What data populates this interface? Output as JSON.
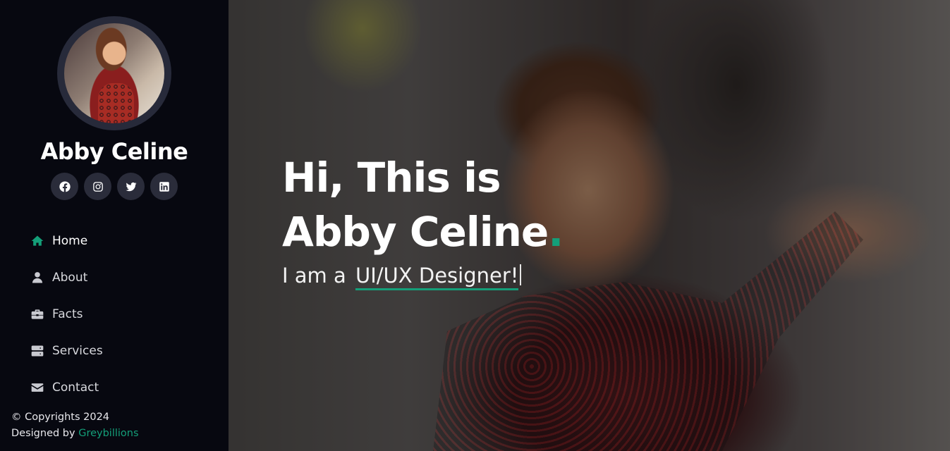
{
  "sidebar": {
    "name": "Abby Celine",
    "socials": [
      {
        "icon": "facebook-icon"
      },
      {
        "icon": "instagram-icon"
      },
      {
        "icon": "twitter-icon"
      },
      {
        "icon": "linkedin-icon"
      }
    ],
    "nav": [
      {
        "label": "Home",
        "icon": "home-icon",
        "active": true
      },
      {
        "label": "About",
        "icon": "user-icon"
      },
      {
        "label": "Facts",
        "icon": "briefcase-icon"
      },
      {
        "label": "Services",
        "icon": "server-icon"
      },
      {
        "label": "Contact",
        "icon": "envelope-icon"
      }
    ],
    "footer": {
      "copyright": "© Copyrights 2024",
      "designed_by": "Designed by",
      "brand": "Greybillions"
    }
  },
  "hero": {
    "line1": "Hi, This is",
    "line2": "Abby Celine",
    "dot": ".",
    "sub_prefix": "I am a",
    "sub_typed": "UI/UX Designer!"
  },
  "colors": {
    "accent": "#149f79",
    "sidebar_bg": "#070810",
    "social_bg": "#2a2c3a"
  }
}
